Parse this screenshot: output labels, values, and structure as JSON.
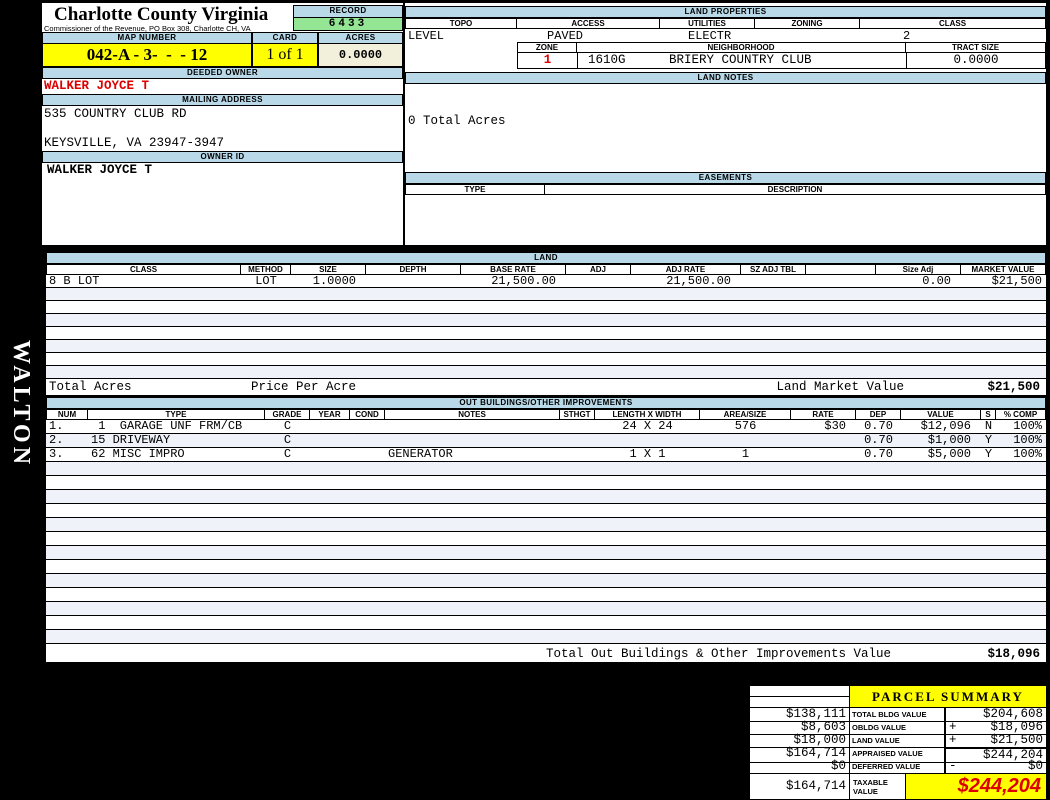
{
  "colors": {
    "header_blue": "#B9D9E8",
    "highlight_yellow": "#FFFF00",
    "record_green": "#94E694",
    "acres_cream": "#F2EFDA",
    "alert_red": "#DD0000",
    "row_tint": "#EFF3F9"
  },
  "sidebar": {
    "vertical_text": "WALTON"
  },
  "header": {
    "county_title": "Charlotte County Virginia",
    "county_subtitle": "Commissioner of the Revenue, PO Box 308, Charlotte CH, VA",
    "record_label": "RECORD",
    "record_value": "6433",
    "map_number_label": "MAP NUMBER",
    "map_number_value": "042-A - 3-  -  - 12",
    "card_label": "CARD",
    "card_value": "1 of 1",
    "acres_label": "ACRES",
    "acres_value": "0.0000"
  },
  "owner": {
    "deeded_owner_label": "DEEDED OWNER",
    "deeded_owner": "WALKER JOYCE T",
    "mailing_address_label": "MAILING ADDRESS",
    "address_line1": "535 COUNTRY CLUB RD",
    "address_line2": "KEYSVILLE, VA 23947-3947",
    "owner_id_label": "OWNER ID",
    "owner_id": "WALKER JOYCE T"
  },
  "land_properties": {
    "section_label": "LAND PROPERTIES",
    "topo_label": "TOPO",
    "access_label": "ACCESS",
    "utilities_label": "UTILITIES",
    "zoning_label": "ZONING",
    "class_label": "CLASS",
    "topo": "LEVEL",
    "access": "PAVED",
    "utilities": "ELECTR",
    "zoning": "",
    "class": "2",
    "zone_label": "ZONE",
    "zone": "1",
    "zone_code": "1610G",
    "neighborhood_label": "NEIGHBORHOOD",
    "neighborhood": "BRIERY COUNTRY CLUB",
    "tract_size_label": "TRACT SIZE",
    "tract_size": "0.0000"
  },
  "land_notes": {
    "section_label": "LAND NOTES",
    "note": "0 Total Acres"
  },
  "easements": {
    "section_label": "EASEMENTS",
    "type_label": "TYPE",
    "description_label": "DESCRIPTION"
  },
  "land": {
    "section_label": "LAND",
    "columns": [
      "CLASS",
      "METHOD",
      "SIZE",
      "DEPTH",
      "BASE RATE",
      "ADJ",
      "ADJ RATE",
      "SZ ADJ TBL",
      "",
      "Size Adj",
      "MARKET VALUE"
    ],
    "rows": [
      {
        "class": "8 B LOT",
        "method": "LOT",
        "size": "1.0000",
        "depth": "",
        "base_rate": "21,500.00",
        "adj": "",
        "adj_rate": "21,500.00",
        "sz_adj_tbl": "",
        "blank": "",
        "size_adj": "0.00",
        "market_value": "$21,500"
      }
    ],
    "empty_row_count": 7,
    "total_acres_label": "Total Acres",
    "price_per_acre_label": "Price Per Acre",
    "land_market_value_label": "Land Market Value",
    "land_market_value": "$21,500"
  },
  "out_buildings": {
    "section_label": "OUT BUILDINGS/OTHER IMPROVEMENTS",
    "columns": [
      "NUM",
      "TYPE",
      "GRADE",
      "YEAR",
      "COND",
      "NOTES",
      "STHGT",
      "LENGTH X WIDTH",
      "AREA/SIZE",
      "RATE",
      "DEP",
      "VALUE",
      "S",
      "% COMP"
    ],
    "rows": [
      {
        "num": "1.",
        "type": " 1  GARAGE UNF FRM/CB",
        "grade": "C",
        "year": "",
        "cond": "",
        "notes": "",
        "sthgt": "",
        "length_width": "24 X 24",
        "area_size": "576",
        "rate": "$30",
        "dep": "0.70",
        "value": "$12,096",
        "s": "N",
        "comp": "100%"
      },
      {
        "num": "2.",
        "type": "15 DRIVEWAY",
        "grade": "C",
        "year": "",
        "cond": "",
        "notes": "",
        "sthgt": "",
        "length_width": "",
        "area_size": "",
        "rate": "",
        "dep": "0.70",
        "value": "$1,000",
        "s": "Y",
        "comp": "100%"
      },
      {
        "num": "3.",
        "type": "62 MISC IMPRO",
        "grade": "C",
        "year": "",
        "cond": "",
        "notes": "GENERATOR",
        "sthgt": "",
        "length_width": "1 X 1",
        "area_size": "1",
        "rate": "",
        "dep": "0.70",
        "value": "$5,000",
        "s": "Y",
        "comp": "100%"
      }
    ],
    "empty_row_count": 13,
    "total_label": "Total Out Buildings & Other Improvements Value",
    "total_value": "$18,096"
  },
  "parcel_summary": {
    "title": "PARCEL SUMMARY",
    "rows": [
      {
        "prior": "$138,111",
        "label": "TOTAL BLDG VALUE",
        "op": "",
        "value": "$204,608"
      },
      {
        "prior": "$8,603",
        "label": "OBLDG VALUE",
        "op": "+",
        "value": "$18,096"
      },
      {
        "prior": "$18,000",
        "label": "LAND VALUE",
        "op": "+",
        "value": "$21,500"
      },
      {
        "prior": "$164,714",
        "label": "APPRAISED VALUE",
        "op": "",
        "value": "$244,204"
      },
      {
        "prior": "$0",
        "label": "DEFERRED VALUE",
        "op": "-",
        "value": "$0"
      }
    ],
    "taxable": {
      "prior": "$164,714",
      "label": "TAXABLE VALUE",
      "value": "$244,204"
    }
  }
}
